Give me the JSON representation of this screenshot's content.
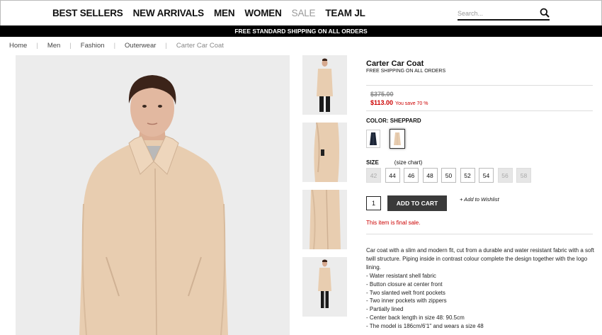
{
  "nav": {
    "links": [
      "BEST SELLERS",
      "NEW ARRIVALS",
      "MEN",
      "WOMEN",
      "SALE",
      "TEAM JL"
    ],
    "search_placeholder": "Search..."
  },
  "shipping_banner": "FREE STANDARD SHIPPING ON ALL ORDERS",
  "breadcrumb": [
    "Home",
    "Men",
    "Fashion",
    "Outerwear",
    "Carter Car Coat"
  ],
  "product": {
    "title": "Carter Car Coat",
    "free_shipping": "FREE SHIPPING ON ALL ORDERS",
    "old_price": "$375.00",
    "new_price": "$113.00",
    "savings": "You save 70 %",
    "color_label": "COLOR: SHEPPARD",
    "size_label": "SIZE",
    "size_chart": "(size chart)",
    "sizes": [
      {
        "label": "42",
        "available": false
      },
      {
        "label": "44",
        "available": true
      },
      {
        "label": "46",
        "available": true
      },
      {
        "label": "48",
        "available": true
      },
      {
        "label": "50",
        "available": true
      },
      {
        "label": "52",
        "available": true
      },
      {
        "label": "54",
        "available": true
      },
      {
        "label": "56",
        "available": false
      },
      {
        "label": "58",
        "available": false
      }
    ],
    "quantity": "1",
    "add_to_cart": "ADD TO CART",
    "wishlist": "+ Add to Wishlist",
    "final_sale": "This item is final sale.",
    "description": "Car coat with a slim and modern fit, cut from a durable and water resistant fabric with a soft twill structure. Piping inside in contrast colour complete the design together with the logo lining.",
    "bullets": [
      "- Water resistant shell fabric",
      "- Button closure at center front",
      "- Two slanted welt front pockets",
      "- Two inner pockets with zippers",
      "- Partially lined",
      "- Center back length in size 48: 90.5cm",
      "- The model is 186cm/6'1\" and wears a size 48"
    ]
  },
  "colors": {
    "coat": "#e8cdb0",
    "navy": "#1c2536",
    "price_red": "#cc0000",
    "button": "#3a3a3a"
  }
}
